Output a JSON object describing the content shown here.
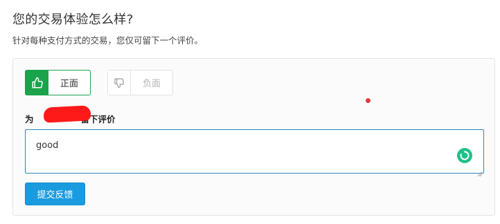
{
  "header": {
    "title": "您的交易体验怎么样?",
    "subtitle": "针对每种支付方式的交易，您仅可留下一个评价。"
  },
  "rating": {
    "positive_label": "正面",
    "positive_icon": "thumbs-up-icon",
    "negative_label": "负面",
    "negative_icon": "thumbs-down-icon",
    "selected": "positive",
    "accent_color": "#1aa34a"
  },
  "review": {
    "label_visible_start": "为",
    "label_visible_end": "留下评价",
    "value": "good"
  },
  "submit": {
    "label": "提交反馈",
    "color": "#1a9be0"
  }
}
